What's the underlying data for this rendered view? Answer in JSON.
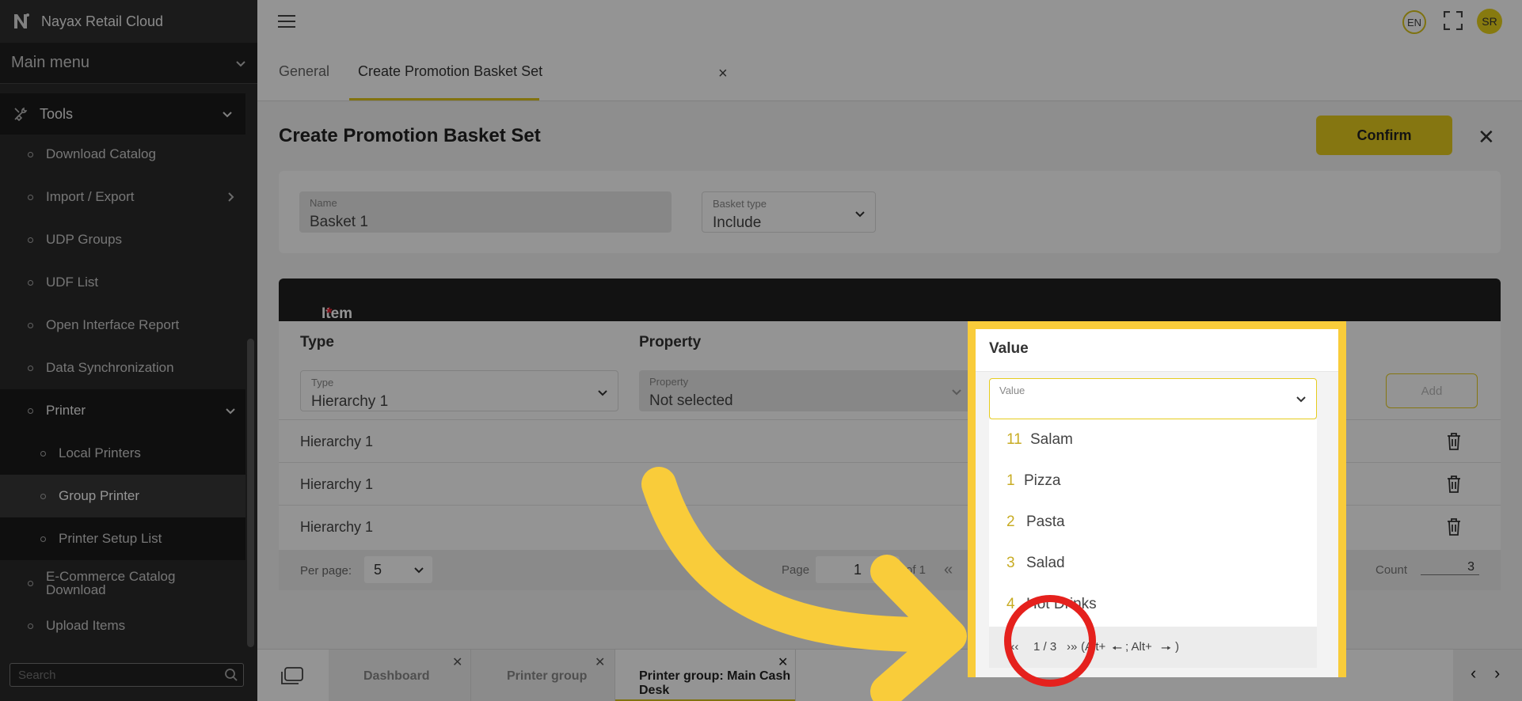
{
  "app": {
    "title": "Nayax Retail Cloud"
  },
  "sidebar": {
    "main_menu": "Main menu",
    "section": "Tools",
    "items": [
      {
        "label": "Download Catalog"
      },
      {
        "label": "Import / Export"
      },
      {
        "label": "UDP Groups"
      },
      {
        "label": "UDF List"
      },
      {
        "label": "Open Interface Report"
      },
      {
        "label": "Data Synchronization"
      },
      {
        "label": "Printer"
      },
      {
        "label": "Local Printers"
      },
      {
        "label": "Group Printer"
      },
      {
        "label": "Printer Setup List"
      },
      {
        "label": "E-Commerce Catalog Download"
      },
      {
        "label": "Upload Items"
      }
    ],
    "search_placeholder": "Search"
  },
  "topbar": {
    "lang": "EN",
    "avatar": "SR"
  },
  "tabs": [
    {
      "label": "General"
    },
    {
      "label": "Create Promotion Basket Set"
    }
  ],
  "page": {
    "title": "Create Promotion Basket Set",
    "confirm": "Confirm",
    "name_label": "Name",
    "name_value": "Basket 1",
    "basket_type_label": "Basket type",
    "basket_type_value": "Include"
  },
  "basket": {
    "title": "Item population basket",
    "required_mark": "*",
    "columns": {
      "type": "Type",
      "property": "Property",
      "value": "Value"
    },
    "type_filter_label": "Type",
    "type_filter_value": "Hierarchy 1",
    "property_filter_label": "Property",
    "property_filter_value": "Not selected",
    "value_filter_label": "Value",
    "add": "Add",
    "rows": [
      {
        "type": "Hierarchy 1"
      },
      {
        "type": "Hierarchy 1"
      },
      {
        "type": "Hierarchy 1"
      }
    ],
    "per_page_label": "Per page:",
    "per_page_value": "5",
    "page_label": "Page",
    "page_value": "1",
    "of_label": "of 1",
    "count_label": "Count",
    "count_value": "3"
  },
  "dropdown": {
    "options": [
      {
        "num": "11",
        "text": "Salam"
      },
      {
        "num": "1",
        "text": "Pizza"
      },
      {
        "num": "2",
        "text": "Pasta"
      },
      {
        "num": "3",
        "text": "Salad"
      },
      {
        "num": "4",
        "text": "Hot Drinks"
      }
    ],
    "pager": {
      "prev": "«‹",
      "page": "1 / 3",
      "next": "›»",
      "hint_open": "(Alt+",
      "hint_mid": "; Alt+",
      "hint_close": ")"
    }
  },
  "taskbar": {
    "tabs": [
      {
        "label": "Dashboard"
      },
      {
        "label": "Printer group"
      },
      {
        "label": "Printer group: Main Cash Desk"
      }
    ]
  },
  "colors": {
    "accent": "#e6cc1e",
    "highlight": "#f9cc3a",
    "annotation": "#e5211d"
  }
}
